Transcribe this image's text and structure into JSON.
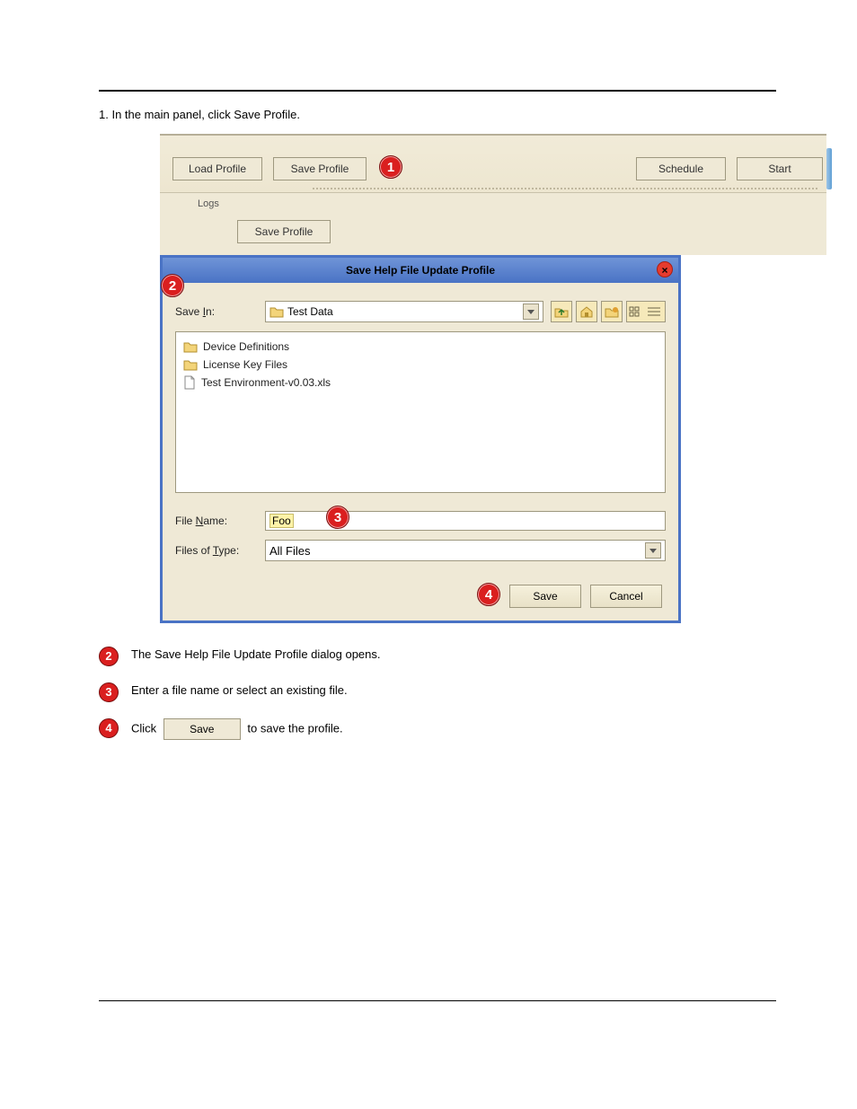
{
  "instr_line1": "1. In the main panel, click Save Profile.",
  "toolbar": {
    "load_profile": "Load Profile",
    "save_profile": "Save Profile",
    "schedule": "Schedule",
    "start": "Start"
  },
  "logs": {
    "label": "Logs",
    "save_profile": "Save Profile"
  },
  "dialog": {
    "title": "Save Help File Update Profile",
    "close": "×",
    "save_in_label_pre": "Save ",
    "save_in_label_u": "I",
    "save_in_label_post": "n:",
    "save_in_value": "Test Data",
    "files": [
      {
        "type": "folder",
        "name": "Device Definitions"
      },
      {
        "type": "folder",
        "name": "License Key Files"
      },
      {
        "type": "file",
        "name": "Test Environment-v0.03.xls"
      }
    ],
    "file_name_label_pre": "File ",
    "file_name_label_u": "N",
    "file_name_label_post": "ame:",
    "file_name_value": "Foo",
    "file_type_label_pre": "Files of ",
    "file_type_label_u": "T",
    "file_type_label_post": "ype:",
    "file_type_value": "All Files",
    "save": "Save",
    "cancel": "Cancel"
  },
  "callouts": {
    "c1": "1",
    "c2": "2",
    "c3": "3",
    "c4": "4"
  },
  "steps": {
    "s2": "The Save Help File Update Profile dialog opens.",
    "s3": "Enter a file name or select an existing file.",
    "s4_pre": "Click ",
    "s4_btn": "Save",
    "s4_post": " to save the profile."
  }
}
